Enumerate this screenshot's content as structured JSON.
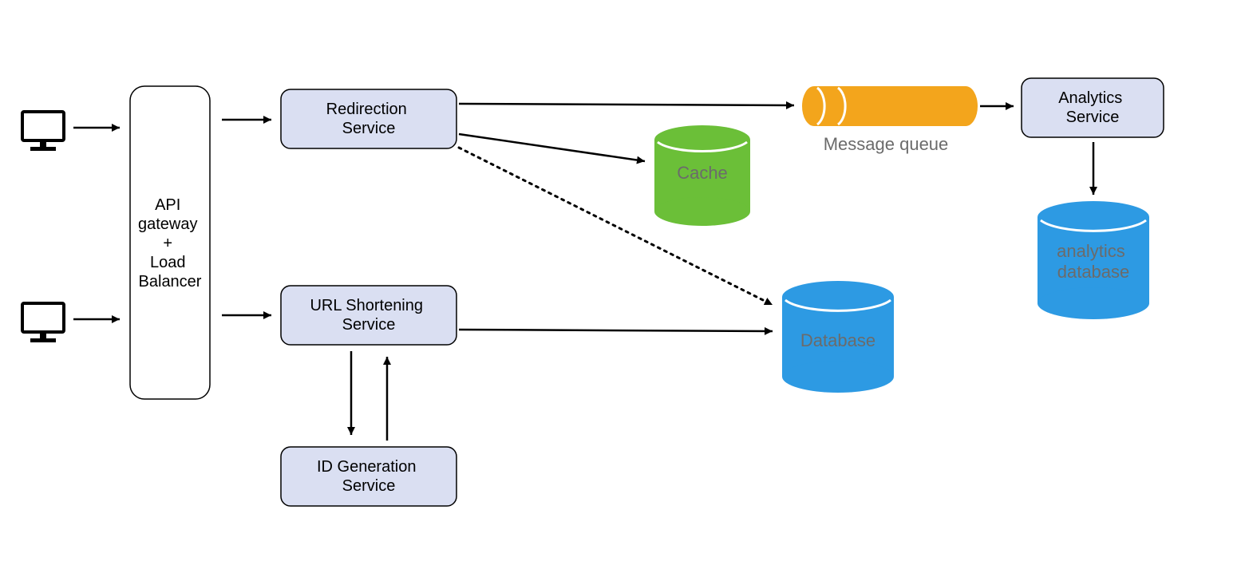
{
  "nodes": {
    "gateway": "API\ngateway\n+\nLoad\nBalancer",
    "redirection": "Redirection\nService",
    "url_shortening": "URL Shortening\nService",
    "id_generation": "ID Generation\nService",
    "analytics_service": "Analytics\nService",
    "cache": "Cache",
    "database": "Database",
    "analytics_db": "analytics\ndatabase",
    "message_queue": "Message queue"
  },
  "colors": {
    "lavender": "#dadff2",
    "green": "#6bbf38",
    "blue": "#2d9ae3",
    "orange": "#f3a51c",
    "grey_text": "#6b6b6b"
  },
  "diagram": {
    "clients": 2,
    "services": [
      "Redirection Service",
      "URL Shortening Service",
      "ID Generation Service",
      "Analytics Service"
    ],
    "stores": [
      "Cache",
      "Database",
      "analytics database",
      "Message queue"
    ]
  }
}
